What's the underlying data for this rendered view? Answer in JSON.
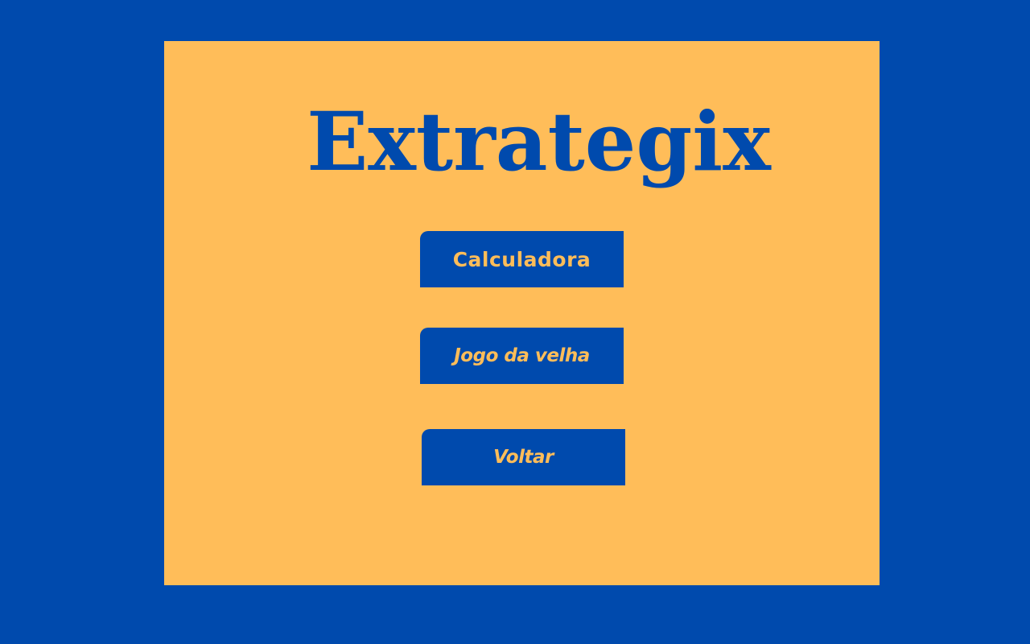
{
  "app": {
    "title": "Extrategix"
  },
  "menu": {
    "buttons": [
      {
        "label": "Calculadora"
      },
      {
        "label": "Jogo da velha"
      },
      {
        "label": "Voltar"
      }
    ]
  },
  "colors": {
    "background": "#004aad",
    "card": "#ffbd59",
    "accent": "#004aad",
    "button_text": "#ffbd59"
  }
}
